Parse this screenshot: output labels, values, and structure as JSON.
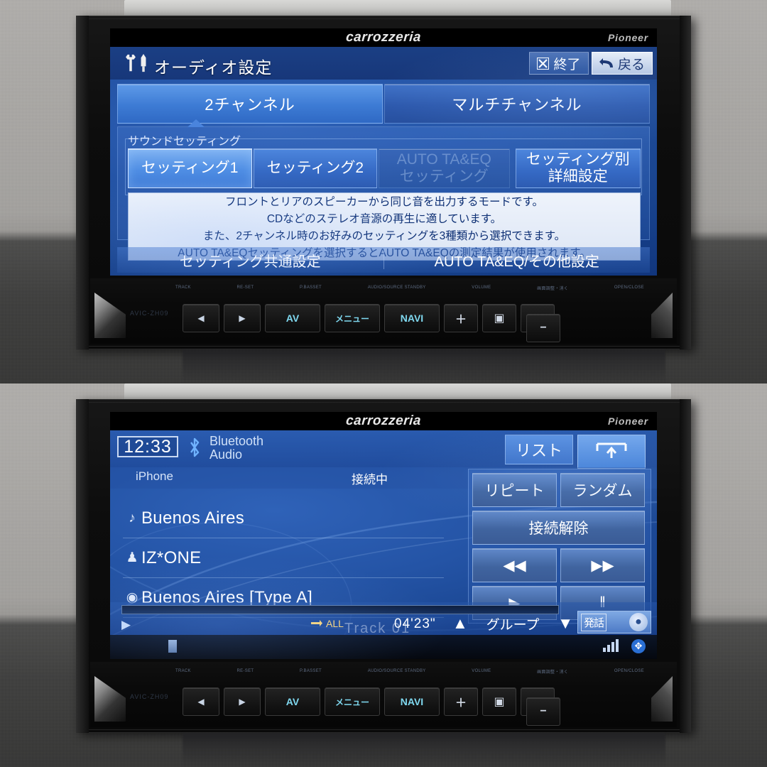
{
  "device": {
    "brand_center": "carrozzeria",
    "brand_right": "Pioneer",
    "model_label": "AVIC-ZH09"
  },
  "deck": {
    "tiny_labels": [
      "TRACK",
      "RE-SET",
      "P.BASSET",
      "AUDIO/SOURCE STANDBY",
      "VOLUME",
      "画面調整・消く",
      "OPEN/CLOSE"
    ],
    "keys": [
      {
        "name": "track-prev",
        "label": "◀"
      },
      {
        "name": "track-next",
        "label": "▶"
      },
      {
        "name": "av",
        "label": "AV"
      },
      {
        "name": "menu",
        "label": "メニュー"
      },
      {
        "name": "navi",
        "label": "NAVI"
      },
      {
        "name": "volume-down",
        "label": "−"
      },
      {
        "name": "volume-up",
        "label": "＋"
      },
      {
        "name": "display",
        "label": "▣"
      },
      {
        "name": "eject",
        "label": "⏏"
      }
    ]
  },
  "settings_screen": {
    "title": "オーディオ設定",
    "exit_label": "終了",
    "back_label": "戻る",
    "channel_tabs": [
      {
        "label": "2チャンネル",
        "active": true
      },
      {
        "label": "マルチチャンネル",
        "active": false
      }
    ],
    "group_label": "サウンドセッティング",
    "setting_buttons": [
      {
        "label": "セッティング1",
        "state": "selected"
      },
      {
        "label": "セッティング2",
        "state": "normal"
      },
      {
        "label_line1": "AUTO TA&EQ",
        "label_line2": "セッティング",
        "state": "disabled"
      },
      {
        "label_line1": "セッティング別",
        "label_line2": "詳細設定",
        "state": "normal"
      }
    ],
    "description_lines": [
      "フロントとリアのスピーカーから同じ音を出力するモードです。",
      "CDなどのステレオ音源の再生に適しています。",
      "また、2チャンネル時のお好みのセッティングを3種類から選択できます。",
      "AUTO TA&EQセッティングを選択するとAUTO TA&EQの測定結果が使用されます。"
    ],
    "footer_buttons": [
      {
        "label": "セッティング共通設定"
      },
      {
        "label": "AUTO TA&EQ/その他設定"
      }
    ]
  },
  "audio_screen": {
    "clock": "12:33",
    "source_line1": "Bluetooth",
    "source_line2": "Audio",
    "tab_list_label": "リスト",
    "device_name": "iPhone",
    "device_status": "接続中",
    "metadata": [
      {
        "icon": "♪",
        "icon_name": "note-icon",
        "text": "Buenos Aires"
      },
      {
        "icon": "♟",
        "icon_name": "artist-icon",
        "text": "IZ*ONE"
      },
      {
        "icon": "◉",
        "icon_name": "album-icon",
        "text": "Buenos Aires [Type A]"
      }
    ],
    "track_number": "Track  01",
    "control_buttons": [
      {
        "name": "repeat",
        "label": "リピート",
        "size": "half"
      },
      {
        "name": "random",
        "label": "ランダム",
        "size": "half"
      },
      {
        "name": "disconnect",
        "label": "接続解除",
        "size": "full"
      },
      {
        "name": "rewind",
        "label": "◀◀",
        "size": "half"
      },
      {
        "name": "fast-forward",
        "label": "▶▶",
        "size": "half"
      },
      {
        "name": "play",
        "label": "▶",
        "size": "half"
      },
      {
        "name": "pause",
        "label": "‖",
        "size": "half"
      }
    ],
    "repeat_mode": "ALL",
    "elapsed_time": "04'23\"",
    "group_label": "グループ",
    "group_up": "▲",
    "group_down": "▼",
    "voice_label": "発話",
    "play_indicator": "▶"
  },
  "colors": {
    "screen_blue": "#2454a6",
    "accent_bright": "#5e9ae8",
    "header_blue": "#1b3f84",
    "text_white": "#ffffff",
    "desc_text": "#0d2f74",
    "key_cyan": "#7fd8ef"
  }
}
